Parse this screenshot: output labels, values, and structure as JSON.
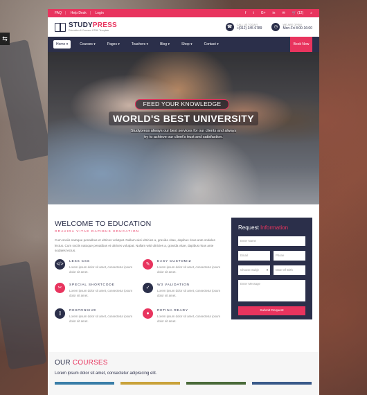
{
  "topbar": {
    "links": [
      "FAQ",
      "Help Desk",
      "Login"
    ],
    "social": [
      "f",
      "t",
      "G+",
      "in",
      "✉"
    ],
    "cart": "(12)"
  },
  "header": {
    "logo_main": "STUDY",
    "logo_accent": "PRESS",
    "logo_tagline": "Education & Courses HTML Template",
    "phone_label": "CALL US TODAY!",
    "phone": "+(012) 345 6789",
    "hours_label": "WE ARE OPEN!",
    "hours": "Mon-Fri 8:00-16:00"
  },
  "nav": {
    "items": [
      "Home",
      "Courses",
      "Pages",
      "Teachers",
      "Blog",
      "Shop",
      "Contact"
    ],
    "book_now": "Book Now"
  },
  "hero": {
    "pill": "FEED YOUR KNOWLEDGE",
    "headline": "WORLD'S BEST UNIVERSITY",
    "sub_1": "Studypress always our best services for our clients and always",
    "sub_2": "try to achieve our client's trust and satisfaction."
  },
  "welcome": {
    "title": "WELCOME TO EDUCATION",
    "kicker": "GRAVIDA VITAE DAPIBUS EDUCATION",
    "intro": "Cum sociis natoque penatibus et ultrices volutpat. Nullam wisi ultricies a, gravida vitae, dapibus risus ante sodales lectus. Cum sociis natoque penatibus et ultrices volutpat. Nullam wisi ultricies a, gravida vitae, dapibus risus ante sodales lectus.",
    "features": [
      {
        "title": "LESS CSS",
        "text": "Lorem ipsum dolor sit amet, consectetur ipsum dolor sit amet.",
        "icon": "code-icon",
        "glyph": "</>"
      },
      {
        "title": "EASY CUSTOMIZ",
        "text": "Lorem ipsum dolor sit amet, consectetur ipsum dolor sit amet.",
        "icon": "pencil-icon",
        "glyph": "✎"
      },
      {
        "title": "SPECIAL SHORTCODE",
        "text": "Lorem ipsum dolor sit amet, consectetur ipsum dolor sit amet.",
        "icon": "scissors-icon",
        "glyph": "✂"
      },
      {
        "title": "W3 VALIDATION",
        "text": "Lorem ipsum dolor sit amet, consectetur ipsum dolor sit amet.",
        "icon": "check-icon",
        "glyph": "✓"
      },
      {
        "title": "RESPONSIVE",
        "text": "Lorem ipsum dolor sit amet, consectetur ipsum dolor sit amet.",
        "icon": "mobile-icon",
        "glyph": "▯"
      },
      {
        "title": "RETINA READY",
        "text": "Lorem ipsum dolor sit amet, consectetur ipsum dolor sit amet.",
        "icon": "location-icon",
        "glyph": "●"
      }
    ]
  },
  "form": {
    "title_main": "Request",
    "title_accent": "Information",
    "name_placeholder": "Enter Name",
    "email_placeholder": "Email",
    "phone_placeholder": "Phone",
    "subject_placeholder": "Choose Subje",
    "dob_placeholder": "Date Of Birth",
    "message_placeholder": "Enter Message",
    "submit": "Submit Request"
  },
  "courses": {
    "title_main": "OUR",
    "title_accent": "COURSES",
    "tagline": "Lorem ipsum dolor sit amet, consectetur adipisicing elit."
  },
  "colors": {
    "accent": "#e8345e",
    "navy": "#2b2f4a"
  }
}
